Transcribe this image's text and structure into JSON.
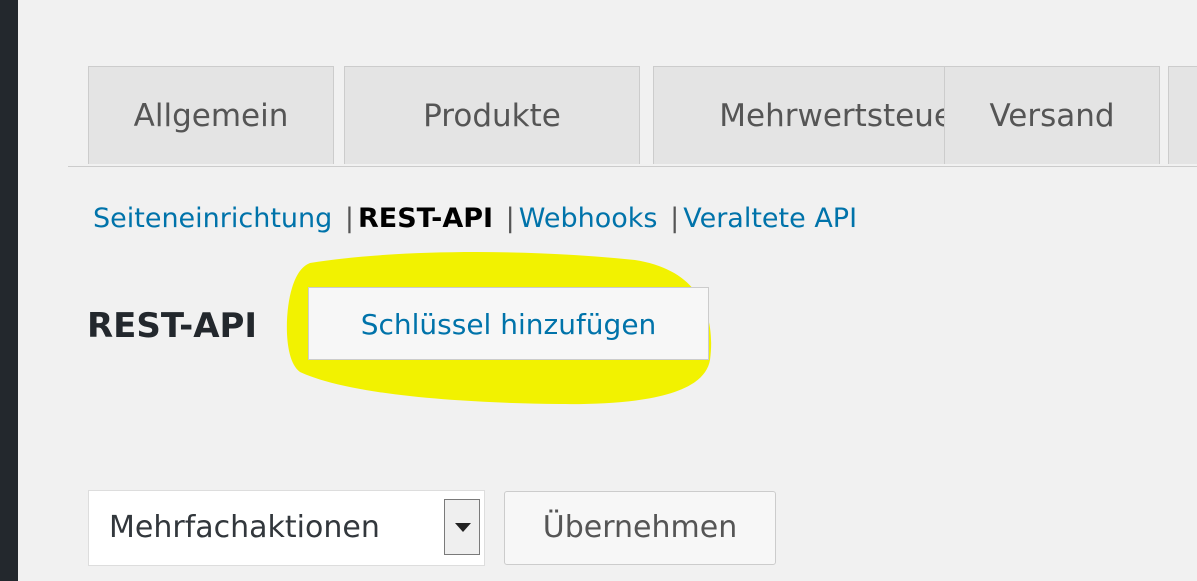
{
  "tabs": [
    {
      "label": "Allgemein"
    },
    {
      "label": "Produkte"
    },
    {
      "label": "Mehrwertsteuer"
    },
    {
      "label": "Versand"
    },
    {
      "label": ""
    }
  ],
  "subnav": {
    "items": [
      {
        "label": "Seiteneinrichtung",
        "current": false
      },
      {
        "label": "REST-API",
        "current": true
      },
      {
        "label": "Webhooks",
        "current": false
      },
      {
        "label": "Veraltete API",
        "current": false
      }
    ],
    "separator": "|"
  },
  "heading": {
    "title": "REST-API",
    "add_key_label": "Schlüssel hinzufügen"
  },
  "bulk_actions": {
    "selected": "Mehrfachaktionen",
    "apply_label": "Übernehmen"
  },
  "colors": {
    "link": "#0073aa",
    "highlight": "#f2f200",
    "admin_bar": "#23282d"
  }
}
